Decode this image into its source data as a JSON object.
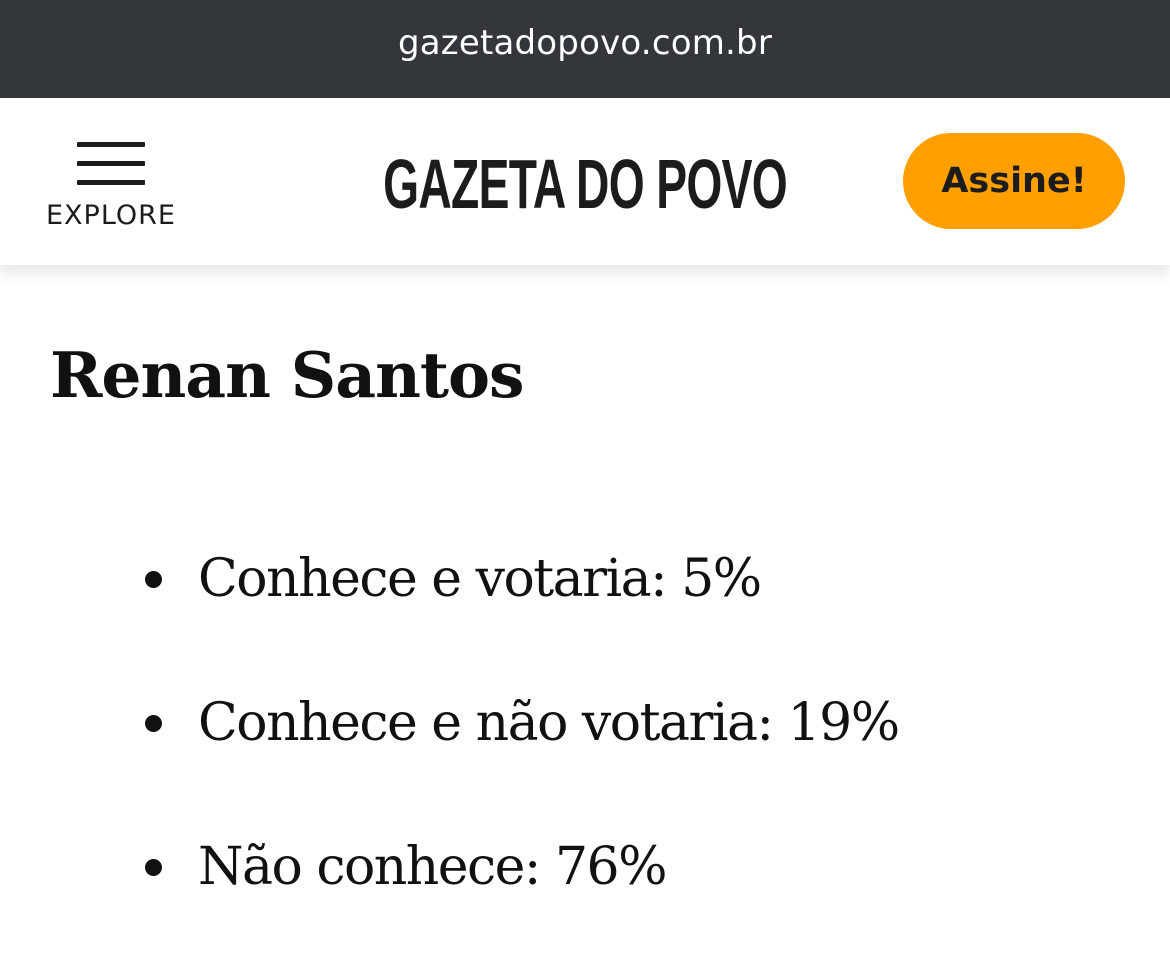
{
  "browser": {
    "url": "gazetadopovo.com.br"
  },
  "header": {
    "explore_label": "EXPLORE",
    "logo_text": "GAZETA DO POVO",
    "subscribe_label": "Assine!",
    "subscribe_color": "#ffa000",
    "menu_icon": "hamburger-icon"
  },
  "article": {
    "heading": "Renan Santos",
    "items": [
      {
        "text": "Conhece e votaria: 5%"
      },
      {
        "text": "Conhece e não votaria: 19%"
      },
      {
        "text": "Não conhece: 76%"
      }
    ]
  }
}
